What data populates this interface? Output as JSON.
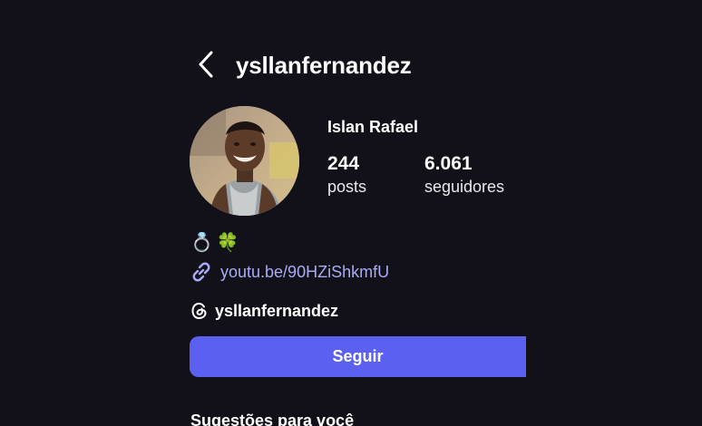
{
  "header": {
    "username": "ysllanfernandez",
    "back_icon": "chevron-left-icon"
  },
  "profile": {
    "display_name": "Islan Rafael",
    "avatar_icon": "profile-photo",
    "stats": {
      "posts_value": "244",
      "posts_label": "posts",
      "followers_value": "6.061",
      "followers_label": "seguidores"
    }
  },
  "bio": {
    "emoji_1": "💍",
    "emoji_2": "🍀",
    "link_icon": "link-icon",
    "link_text": "youtu.be/90HZiShkmfU",
    "threads_icon": "threads-icon",
    "threads_handle": "ysllanfernandez"
  },
  "actions": {
    "follow_label": "Seguir"
  },
  "suggestions": {
    "title": "Sugestões para você"
  },
  "colors": {
    "background": "#12111a",
    "accent": "#5b60f0",
    "link": "#a9acf5",
    "text": "#ffffff"
  }
}
